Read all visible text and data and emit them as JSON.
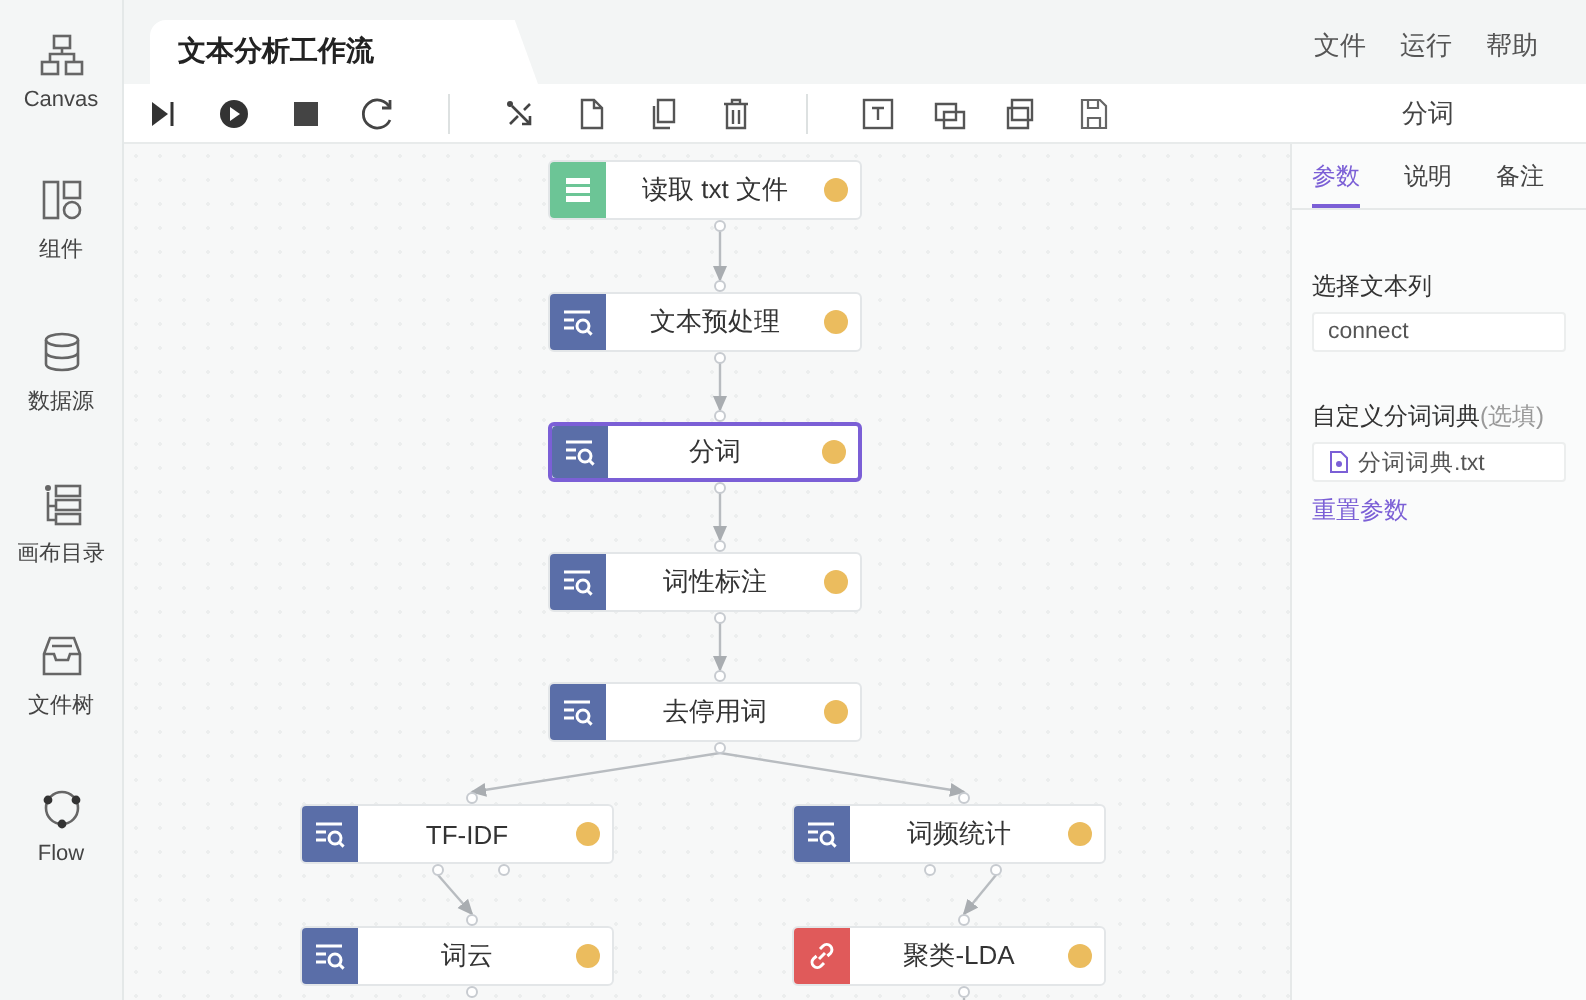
{
  "sidebar": {
    "items": [
      {
        "label": "Canvas",
        "kind": "hierarchy"
      },
      {
        "label": "组件",
        "kind": "layout"
      },
      {
        "label": "数据源",
        "kind": "database"
      },
      {
        "label": "画布目录",
        "kind": "outline"
      },
      {
        "label": "文件树",
        "kind": "inbox"
      },
      {
        "label": "Flow",
        "kind": "nodes"
      }
    ]
  },
  "tab": {
    "title": "文本分析工作流"
  },
  "menu": [
    "文件",
    "运行",
    "帮助"
  ],
  "toolbar": {
    "selected_label": "分词"
  },
  "flow": {
    "nodes": [
      {
        "label": "读取 txt 文件",
        "kind": "reader",
        "selected": false
      },
      {
        "label": "文本预处理",
        "kind": "process",
        "selected": false
      },
      {
        "label": "分词",
        "kind": "process",
        "selected": true
      },
      {
        "label": "词性标注",
        "kind": "process",
        "selected": false
      },
      {
        "label": "去停用词",
        "kind": "process",
        "selected": false
      },
      {
        "label": "TF-IDF",
        "kind": "process",
        "selected": false
      },
      {
        "label": "词频统计",
        "kind": "process",
        "selected": false
      },
      {
        "label": "词云",
        "kind": "process",
        "selected": false
      },
      {
        "label": "聚类-LDA",
        "kind": "model",
        "selected": false
      }
    ]
  },
  "panel": {
    "tabs": [
      {
        "label": "参数",
        "selected": true
      },
      {
        "label": "说明",
        "selected": false
      },
      {
        "label": "备注",
        "selected": false
      }
    ],
    "text_column": {
      "label": "选择文本列",
      "value": "connect"
    },
    "dictionary": {
      "label": "自定义分词词典",
      "hint": "(选填)",
      "file": "分词词典.txt"
    },
    "reset_link": "重置参数"
  }
}
